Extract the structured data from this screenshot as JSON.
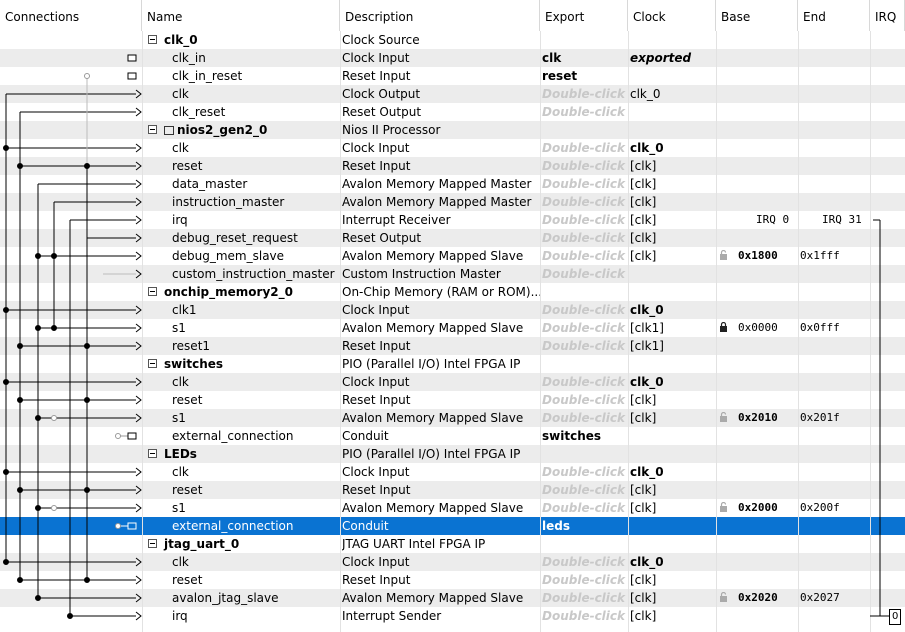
{
  "columns": [
    "Connections",
    "Name",
    "Description",
    "Export",
    "Clock",
    "Base",
    "End",
    "IRQ"
  ],
  "double_click_label": "Double-click",
  "rows": [
    {
      "kind": "comp",
      "name": "clk_0",
      "desc": "Clock Source",
      "export": "",
      "clock": "",
      "base": "",
      "end": ""
    },
    {
      "kind": "iface",
      "name": "clk_in",
      "desc": "Clock Input",
      "export": "clk",
      "clock": "exported",
      "clock_style": "exported",
      "base": "",
      "end": ""
    },
    {
      "kind": "iface",
      "name": "clk_in_reset",
      "desc": "Reset Input",
      "export": "reset",
      "clock": "",
      "base": "",
      "end": ""
    },
    {
      "kind": "iface",
      "name": "clk",
      "desc": "Clock Output",
      "export": "Double-click",
      "clock": "clk_0",
      "base": "",
      "end": ""
    },
    {
      "kind": "iface",
      "name": "clk_reset",
      "desc": "Reset Output",
      "export": "Double-click",
      "clock": "",
      "base": "",
      "end": ""
    },
    {
      "kind": "comp",
      "name": "nios2_gen2_0",
      "icon": "processor-icon",
      "desc": "Nios II Processor",
      "export": "",
      "clock": "",
      "base": "",
      "end": ""
    },
    {
      "kind": "iface",
      "name": "clk",
      "desc": "Clock Input",
      "export": "Double-click",
      "clock": "clk_0",
      "clock_style": "bold",
      "base": "",
      "end": ""
    },
    {
      "kind": "iface",
      "name": "reset",
      "desc": "Reset Input",
      "export": "Double-click",
      "clock": "[clk]",
      "base": "",
      "end": ""
    },
    {
      "kind": "iface",
      "name": "data_master",
      "desc": "Avalon Memory Mapped Master",
      "export": "Double-click",
      "clock": "[clk]",
      "base": "",
      "end": ""
    },
    {
      "kind": "iface",
      "name": "instruction_master",
      "desc": "Avalon Memory Mapped Master",
      "export": "Double-click",
      "clock": "[clk]",
      "base": "",
      "end": ""
    },
    {
      "kind": "iface",
      "name": "irq",
      "desc": "Interrupt Receiver",
      "export": "Double-click",
      "clock": "[clk]",
      "irq_start": "IRQ 0",
      "irq_end": "IRQ 31",
      "base": "",
      "end": ""
    },
    {
      "kind": "iface",
      "name": "debug_reset_request",
      "desc": "Reset Output",
      "export": "Double-click",
      "clock": "[clk]",
      "base": "",
      "end": ""
    },
    {
      "kind": "iface",
      "name": "debug_mem_slave",
      "desc": "Avalon Memory Mapped Slave",
      "export": "Double-click",
      "clock": "[clk]",
      "base": "0x1800",
      "end": "0x1fff",
      "base_bold": true,
      "lock": "unlocked"
    },
    {
      "kind": "iface",
      "name": "custom_instruction_master",
      "desc": "Custom Instruction Master",
      "export": "Double-click",
      "clock": "",
      "base": "",
      "end": ""
    },
    {
      "kind": "comp",
      "name": "onchip_memory2_0",
      "desc": "On-Chip Memory (RAM or ROM)...",
      "export": "",
      "clock": "",
      "base": "",
      "end": ""
    },
    {
      "kind": "iface",
      "name": "clk1",
      "desc": "Clock Input",
      "export": "Double-click",
      "clock": "clk_0",
      "clock_style": "bold",
      "base": "",
      "end": ""
    },
    {
      "kind": "iface",
      "name": "s1",
      "desc": "Avalon Memory Mapped Slave",
      "export": "Double-click",
      "clock": "[clk1]",
      "base": "0x0000",
      "end": "0x0fff",
      "base_bold": false,
      "lock": "locked"
    },
    {
      "kind": "iface",
      "name": "reset1",
      "desc": "Reset Input",
      "export": "Double-click",
      "clock": "[clk1]",
      "base": "",
      "end": ""
    },
    {
      "kind": "comp",
      "name": "switches",
      "desc": "PIO (Parallel I/O) Intel FPGA IP",
      "export": "",
      "clock": "",
      "base": "",
      "end": ""
    },
    {
      "kind": "iface",
      "name": "clk",
      "desc": "Clock Input",
      "export": "Double-click",
      "clock": "clk_0",
      "clock_style": "bold",
      "base": "",
      "end": ""
    },
    {
      "kind": "iface",
      "name": "reset",
      "desc": "Reset Input",
      "export": "Double-click",
      "clock": "[clk]",
      "base": "",
      "end": ""
    },
    {
      "kind": "iface",
      "name": "s1",
      "desc": "Avalon Memory Mapped Slave",
      "export": "Double-click",
      "clock": "[clk]",
      "base": "0x2010",
      "end": "0x201f",
      "base_bold": true,
      "lock": "unlocked"
    },
    {
      "kind": "iface",
      "name": "external_connection",
      "desc": "Conduit",
      "export": "switches",
      "clock": "",
      "base": "",
      "end": ""
    },
    {
      "kind": "comp",
      "name": "LEDs",
      "desc": "PIO (Parallel I/O) Intel FPGA IP",
      "export": "",
      "clock": "",
      "base": "",
      "end": ""
    },
    {
      "kind": "iface",
      "name": "clk",
      "desc": "Clock Input",
      "export": "Double-click",
      "clock": "clk_0",
      "clock_style": "bold",
      "base": "",
      "end": ""
    },
    {
      "kind": "iface",
      "name": "reset",
      "desc": "Reset Input",
      "export": "Double-click",
      "clock": "[clk]",
      "base": "",
      "end": ""
    },
    {
      "kind": "iface",
      "name": "s1",
      "desc": "Avalon Memory Mapped Slave",
      "export": "Double-click",
      "clock": "[clk]",
      "base": "0x2000",
      "end": "0x200f",
      "base_bold": true,
      "lock": "unlocked"
    },
    {
      "kind": "iface",
      "name": "external_connection",
      "desc": "Conduit",
      "export": "leds",
      "clock": "",
      "base": "",
      "end": "",
      "selected": true
    },
    {
      "kind": "comp",
      "name": "jtag_uart_0",
      "desc": "JTAG UART Intel FPGA IP",
      "export": "",
      "clock": "",
      "base": "",
      "end": ""
    },
    {
      "kind": "iface",
      "name": "clk",
      "desc": "Clock Input",
      "export": "Double-click",
      "clock": "clk_0",
      "clock_style": "bold",
      "base": "",
      "end": ""
    },
    {
      "kind": "iface",
      "name": "reset",
      "desc": "Reset Input",
      "export": "Double-click",
      "clock": "[clk]",
      "base": "",
      "end": ""
    },
    {
      "kind": "iface",
      "name": "avalon_jtag_slave",
      "desc": "Avalon Memory Mapped Slave",
      "export": "Double-click",
      "clock": "[clk]",
      "base": "0x2020",
      "end": "0x2027",
      "base_bold": true,
      "lock": "unlocked"
    },
    {
      "kind": "iface",
      "name": "irq",
      "desc": "Interrupt Sender",
      "export": "Double-click",
      "clock": "[clk]",
      "base": "",
      "end": "",
      "irq_sender": "0"
    }
  ],
  "colors": {
    "selection": "#0a73d2",
    "alt_row": "#ececec",
    "double_click": "#c8c8c8",
    "wire": "#000000"
  }
}
